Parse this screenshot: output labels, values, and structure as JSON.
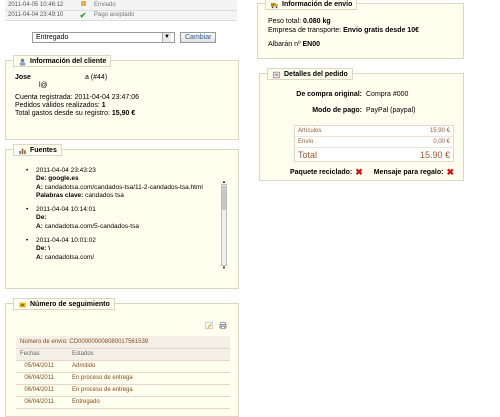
{
  "history": [
    {
      "date": "2011-04-05 10:46:12",
      "status": "Enviado",
      "icon": "status-icon",
      "color": "#777777"
    },
    {
      "date": "2011-04-04 23:49:10",
      "status": "Pago aceptado",
      "icon": "check-icon",
      "color": "#2e9b2e"
    }
  ],
  "status_change": {
    "selected": "Entregado",
    "button": "Cambiar"
  },
  "client": {
    "title": "Información del cliente",
    "name": "Jose",
    "name_suffix": "a (#44)",
    "email_fragment": "l@",
    "registered": "Cuenta registrada: 2011-04-04 23:47:06",
    "valid_orders_label": "Pedidos válidos realizados:",
    "valid_orders_value": "1",
    "total_label": "Total gastos desde su registro:",
    "total_value": "15,90 €"
  },
  "sources": {
    "title": "Fuentes",
    "items": [
      {
        "date": "2011-04-04 23:43:23",
        "from": "google.es",
        "to": "candadotsa.com/candados-tsa/11-2-candados-tsa.html",
        "keywords_label": "Palabras clave:",
        "keywords": "candados tsa"
      },
      {
        "date": "2011-04-04 10:14:01",
        "from": "",
        "to": "candadotsa.com/5-candados-tsa",
        "keywords_label": "",
        "keywords": ""
      },
      {
        "date": "2011-04-04 10:01:02",
        "from": "\\",
        "to": "candadotsa.com/",
        "keywords_label": "",
        "keywords": ""
      }
    ],
    "de_label": "De:",
    "a_label": "A:"
  },
  "tracking": {
    "title": "Número de seguimiento",
    "shipping_number_label": "Número de envío:",
    "shipping_number": "CD000000008080017561539",
    "col_dates": "Fechas",
    "col_status": "Estados",
    "rows": [
      {
        "date": "05/04/2011",
        "status": "Admitido"
      },
      {
        "date": "06/04/2011",
        "status": "En proceso de entrega"
      },
      {
        "date": "06/04/2011",
        "status": "En proceso de entrega"
      },
      {
        "date": "06/04/2011",
        "status": "Entregado"
      }
    ]
  },
  "shipping": {
    "title": "Información de envío",
    "weight_label": "Peso total:",
    "weight": "0.080 kg",
    "carrier_label": "Empresa de transporte:",
    "carrier": "Envío gratis desde 10€",
    "delivery_label": "Albarán nº",
    "delivery": "EN00"
  },
  "order": {
    "title": "Detalles del pedido",
    "original_label": "De compra original:",
    "original": "Compra #000",
    "payment_label": "Modo de pago:",
    "payment": "PayPal (paypal)",
    "prices": [
      {
        "label": "Artículos",
        "value": "15,90 €"
      },
      {
        "label": "Envío",
        "value": "0,00 €"
      }
    ],
    "total_label": "Total",
    "total_value": "15.90 €"
  },
  "flags": {
    "recycled_label": "Paquete reciclado:",
    "gift_label": "Mensaje para regalo:"
  }
}
